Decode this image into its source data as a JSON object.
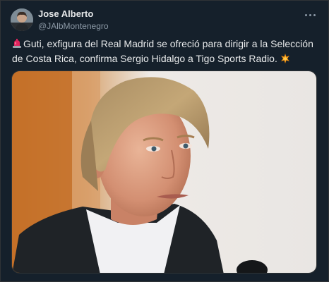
{
  "author": {
    "name": "Jose Alberto",
    "handle": "@JAlbMontenegro",
    "avatar_icon": "profile-photo"
  },
  "tweet": {
    "text": "Guti, exfigura del Real Madrid se ofreció para dirigir a la Selección de Costa Rica, confirma Sergio Hidalgo a Tigo Sports Radio.",
    "leading_emoji": "police-light-emoji",
    "trailing_emoji": "collision-emoji"
  },
  "media": {
    "kind": "photo",
    "subject": "man-with-blond-hair-speaking-at-microphone"
  },
  "colors": {
    "background": "#15202b",
    "text": "#e7e9ea",
    "secondary_text": "#8b98a5",
    "border": "#2f3336"
  },
  "icons": {
    "more_menu": "more-horizontal-icon"
  }
}
